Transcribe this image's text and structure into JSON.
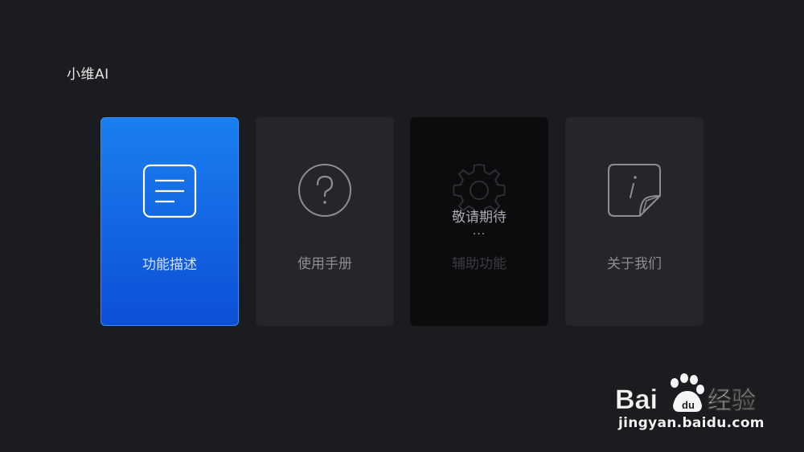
{
  "app": {
    "title": "小维AI"
  },
  "cards": [
    {
      "label": "功能描述",
      "icon": "document-list-icon",
      "selected": true,
      "disabled": false
    },
    {
      "label": "使用手册",
      "icon": "question-circle-icon",
      "selected": false,
      "disabled": false
    },
    {
      "label": "辅助功能",
      "icon": "gear-icon",
      "selected": false,
      "disabled": true,
      "overlay_text": "敬请期待",
      "overlay_dots": "..."
    },
    {
      "label": "关于我们",
      "icon": "info-note-icon",
      "selected": false,
      "disabled": false
    }
  ],
  "watermark": {
    "brand": "Bai百度经验",
    "url": "jingyan.baidu.com"
  },
  "colors": {
    "background": "#1b1c20",
    "card": "#25262b",
    "selected_top": "#1a7ff0",
    "selected_bottom": "#0d4fd6"
  }
}
